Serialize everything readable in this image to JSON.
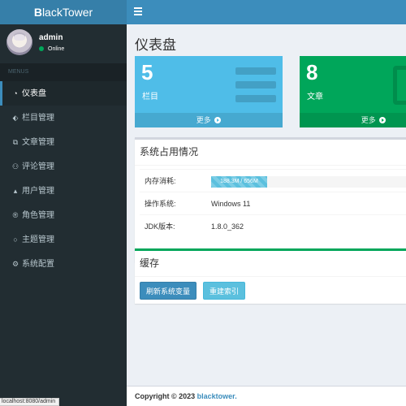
{
  "header": {
    "logo_prefix": "B",
    "logo_rest": "lackTower"
  },
  "user": {
    "name": "admin",
    "status": "Online"
  },
  "sidebar": {
    "header": "MENUS",
    "items": [
      {
        "label": "仪表盘",
        "icon": "dashboard-icon",
        "glyph": "◔"
      },
      {
        "label": "栏目管理",
        "icon": "tag-icon",
        "glyph": "⬖"
      },
      {
        "label": "文章管理",
        "icon": "copy-icon",
        "glyph": "⧉"
      },
      {
        "label": "评论管理",
        "icon": "comments-icon",
        "glyph": "⚇"
      },
      {
        "label": "用户管理",
        "icon": "user-icon",
        "glyph": "▴"
      },
      {
        "label": "角色管理",
        "icon": "registered-icon",
        "glyph": "®"
      },
      {
        "label": "主题管理",
        "icon": "circle-icon",
        "glyph": "○"
      },
      {
        "label": "系统配置",
        "icon": "gear-icon",
        "glyph": "⚙"
      }
    ]
  },
  "status_bar_url": "localhost:8080/admin",
  "page_title": "仪表盘",
  "cards": [
    {
      "number": "5",
      "label": "栏目",
      "more": "更多",
      "color": "#4fbde8"
    },
    {
      "number": "8",
      "label": "文章",
      "more": "更多",
      "color": "#00a65a"
    }
  ],
  "system": {
    "title": "系统占用情况",
    "memory_label": "内存消耗:",
    "memory_text": "188.3M / 656M",
    "memory_fraction": 0.287,
    "os_label": "操作系统:",
    "os_value": "Windows 11",
    "jdk_label": "JDK版本:",
    "jdk_value": "1.8.0_362"
  },
  "cache": {
    "title": "缓存",
    "refresh_button": "刷新系统变量",
    "rebuild_button": "重建索引"
  },
  "footer": {
    "copyright": "Copyright © 2023",
    "brand": "blacktower."
  }
}
